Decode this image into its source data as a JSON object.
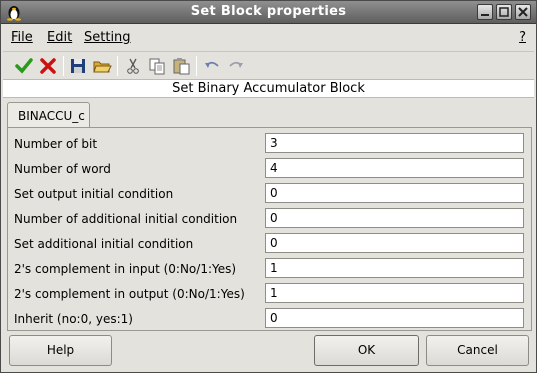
{
  "window": {
    "title": "Set Block properties",
    "controls": {
      "minimize": "minimize-icon",
      "maximize": "maximize-icon",
      "close": "close-icon"
    }
  },
  "menubar": {
    "items": [
      {
        "label": "File",
        "underline": "F"
      },
      {
        "label": "Edit",
        "underline": "E"
      },
      {
        "label": "Setting",
        "underline": "S"
      }
    ],
    "help": "?"
  },
  "toolbar": {
    "icons": [
      "check-icon",
      "cancel-x-icon",
      "save-icon",
      "open-folder-icon",
      "cut-icon",
      "copy-icon",
      "paste-icon",
      "undo-icon",
      "redo-icon"
    ],
    "colors": {
      "check": "#2a9a1a",
      "cancel": "#cc1111"
    }
  },
  "header": {
    "text": "Set Binary Accumulator Block"
  },
  "tab": {
    "label": "BINACCU_c"
  },
  "fields": [
    {
      "label": "Number of bit",
      "value": "3"
    },
    {
      "label": "Number of word",
      "value": "4"
    },
    {
      "label": "Set output initial condition",
      "value": "0"
    },
    {
      "label": "Number of additional initial condition",
      "value": "0"
    },
    {
      "label": "Set additional initial condition",
      "value": "0"
    },
    {
      "label": "2's complement in input (0:No/1:Yes)",
      "value": "1"
    },
    {
      "label": "2's complement in output (0:No/1:Yes)",
      "value": "1"
    },
    {
      "label": "Inherit (no:0, yes:1)",
      "value": "0"
    }
  ],
  "buttons": {
    "help": "Help",
    "ok": "OK",
    "cancel": "Cancel"
  }
}
